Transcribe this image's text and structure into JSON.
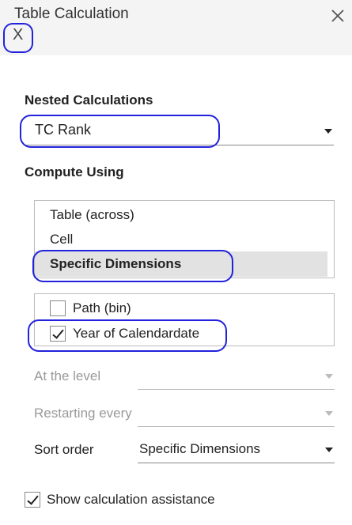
{
  "dialog": {
    "title": "Table Calculation",
    "x_label": "X"
  },
  "nested": {
    "label": "Nested Calculations",
    "value": "TC Rank"
  },
  "compute": {
    "label": "Compute Using",
    "options": [
      "Table (across)",
      "Cell",
      "Specific Dimensions"
    ],
    "selected": "Specific Dimensions"
  },
  "dimensions": [
    {
      "label": "Path (bin)",
      "checked": false
    },
    {
      "label": "Year of Calendardate",
      "checked": true
    }
  ],
  "level": {
    "label": "At the level",
    "value": ""
  },
  "restarting": {
    "label": "Restarting every",
    "value": ""
  },
  "sort": {
    "label": "Sort order",
    "value": "Specific Dimensions"
  },
  "assist": {
    "label": "Show calculation assistance",
    "checked": true
  },
  "colors": {
    "annotation": "#2222dd",
    "selected_bg": "#e2e2e2",
    "header_bg": "#f4f4f4"
  }
}
